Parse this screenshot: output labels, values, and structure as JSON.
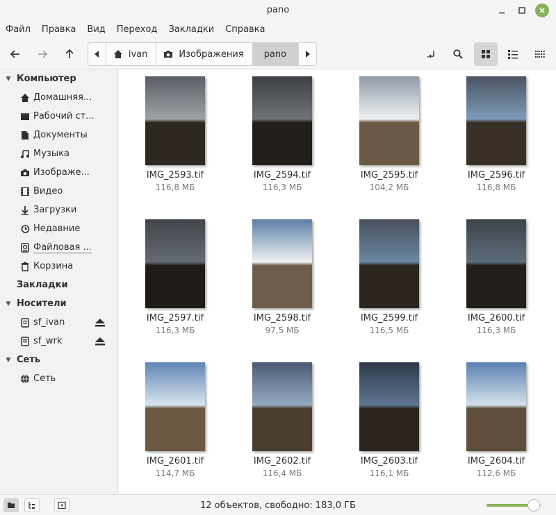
{
  "window": {
    "title": "pano"
  },
  "menu": [
    "Файл",
    "Правка",
    "Вид",
    "Переход",
    "Закладки",
    "Справка"
  ],
  "pathbar": {
    "segments": [
      "ivan",
      "Изображения",
      "pano"
    ]
  },
  "sidebar": {
    "computer_header": "Компьютер",
    "computer_items": [
      {
        "label": "Домашняя...",
        "icon": "home-icon"
      },
      {
        "label": "Рабочий ст...",
        "icon": "desktop-icon"
      },
      {
        "label": "Документы",
        "icon": "document-icon"
      },
      {
        "label": "Музыка",
        "icon": "music-icon"
      },
      {
        "label": "Изображе...",
        "icon": "camera-icon"
      },
      {
        "label": "Видео",
        "icon": "film-icon"
      },
      {
        "label": "Загрузки",
        "icon": "download-icon"
      },
      {
        "label": "Недавние",
        "icon": "history-icon"
      },
      {
        "label": "Файловая ...",
        "icon": "drive-icon"
      },
      {
        "label": "Корзина",
        "icon": "trash-icon"
      }
    ],
    "bookmarks_header": "Закладки",
    "devices_header": "Носители",
    "devices_items": [
      {
        "label": "sf_ivan",
        "icon": "drive-icon"
      },
      {
        "label": "sf_wrk",
        "icon": "drive-icon"
      }
    ],
    "network_header": "Сеть",
    "network_items": [
      {
        "label": "Сеть",
        "icon": "network-icon"
      }
    ]
  },
  "files": [
    {
      "name": "IMG_2593.tif",
      "size": "116,8 МБ",
      "sky_top": "#5a5f66",
      "sky_bottom": "#9ea3a8",
      "ground": "#2e2820",
      "exposure": "dark"
    },
    {
      "name": "IMG_2594.tif",
      "size": "116,3 МБ",
      "sky_top": "#3c3f44",
      "sky_bottom": "#6f7276",
      "ground": "#221e19",
      "exposure": "darker"
    },
    {
      "name": "IMG_2595.tif",
      "size": "104,2 МБ",
      "sky_top": "#8f99a6",
      "sky_bottom": "#eef1f4",
      "ground": "#6a5a45",
      "exposure": "bright"
    },
    {
      "name": "IMG_2596.tif",
      "size": "116,8 МБ",
      "sky_top": "#4a5563",
      "sky_bottom": "#7d9bb8",
      "ground": "#3a3026",
      "exposure": "dark"
    },
    {
      "name": "IMG_2597.tif",
      "size": "116,3 МБ",
      "sky_top": "#41454b",
      "sky_bottom": "#646b72",
      "ground": "#1f1b17",
      "exposure": "darker"
    },
    {
      "name": "IMG_2598.tif",
      "size": "97,5 МБ",
      "sky_top": "#5d7fa8",
      "sky_bottom": "#eef1f4",
      "ground": "#6e5e49",
      "exposure": "bright"
    },
    {
      "name": "IMG_2599.tif",
      "size": "116,5 МБ",
      "sky_top": "#48505a",
      "sky_bottom": "#6b86a4",
      "ground": "#2c261f",
      "exposure": "dark"
    },
    {
      "name": "IMG_2600.tif",
      "size": "116,3 МБ",
      "sky_top": "#3d434a",
      "sky_bottom": "#5c6c7c",
      "ground": "#221e1a",
      "exposure": "darker"
    },
    {
      "name": "IMG_2601.tif",
      "size": "114,7 МБ",
      "sky_top": "#5f86b5",
      "sky_bottom": "#d9e4ee",
      "ground": "#6b5943",
      "exposure": "bright"
    },
    {
      "name": "IMG_2602.tif",
      "size": "116,4 МБ",
      "sky_top": "#4a5b73",
      "sky_bottom": "#93aac3",
      "ground": "#4a3d30",
      "exposure": "dark"
    },
    {
      "name": "IMG_2603.tif",
      "size": "116,1 МБ",
      "sky_top": "#2f3a4a",
      "sky_bottom": "#5d7590",
      "ground": "#2d261f",
      "exposure": "darker"
    },
    {
      "name": "IMG_2604.tif",
      "size": "112,6 МБ",
      "sky_top": "#5a82b2",
      "sky_bottom": "#d5e0ea",
      "ground": "#5e4e3b",
      "exposure": "bright"
    }
  ],
  "status": {
    "text": "12 объектов, свободно: 183,0 ГБ",
    "zoom_level": 0.85
  },
  "colors": {
    "accent": "#8bb158"
  }
}
